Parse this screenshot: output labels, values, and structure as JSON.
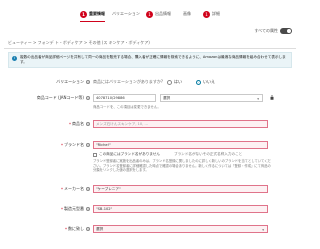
{
  "tabs": [
    {
      "num": "1",
      "label": "重要情報",
      "active": true
    },
    {
      "num": "",
      "label": "バリエーション",
      "active": false
    },
    {
      "num": "1",
      "label": "出品情報",
      "active": false
    },
    {
      "num": "",
      "label": "画像",
      "active": false
    },
    {
      "num": "1",
      "label": "詳細",
      "active": false
    }
  ],
  "toggle_label": "すべての属性",
  "breadcrumb": "ビューティー > フォンデ ト・ボディケア > その他 (ス キンケア・ボディケア)",
  "notice": "複数の出品者が商品詳細ページを共有して同一の商品を販売する場合、購入者が正確に情報を検索できるように、Amazonは最適な商品情報を組み合わせて表示します。",
  "variation": {
    "label": "バリエーション",
    "question": "商品にはバリエーションがありますか?",
    "yes": "はい",
    "no": "いいえ"
  },
  "product_code": {
    "label": "商品コード (JANコード等)",
    "value": "4078710/29886",
    "select": "選択",
    "hint": "商品コードを、この項目は変更できません。"
  },
  "product_name": {
    "label": "商品名",
    "placeholder": "メンズ石けんスキンケア, 10, ..."
  },
  "brand": {
    "label": "ブランド名",
    "value": "\"Riche!\"",
    "checkbox": "この商品にはブランド名がありません",
    "checkbox_hint": "ブランド名がないその正式名称入力のこと",
    "desc": "ブランド登録者に実施を出品者のみは、ブランド名登録に関しましたのに詳しく新しいのブランドを当てとしていてください。ブランド名登録者に詳細確認した時点で確認の場合ありません。新しく作るについては「登録・作成」にて商品の分類をリンクした値の選択をします。"
  },
  "manufacturer": {
    "label": "メーカー名",
    "value": "\"ケーブレニア\""
  },
  "model_number": {
    "label": "製造元型番",
    "value": "\"SB-102\""
  },
  "unit": {
    "label": "数に致し",
    "value": "選択"
  }
}
